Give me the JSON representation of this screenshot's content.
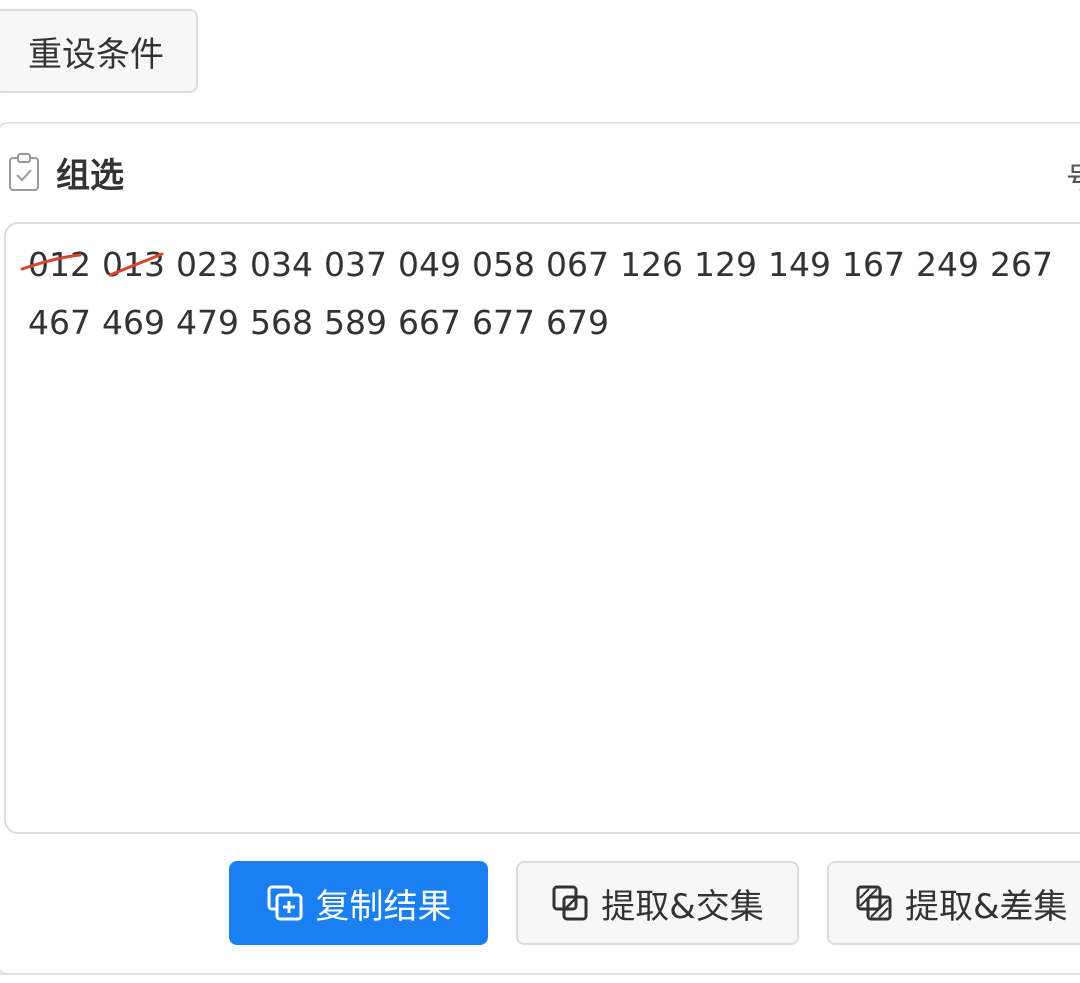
{
  "toolbar": {
    "reset_label": "重设条件"
  },
  "panel": {
    "title": "组选",
    "edge_glyph": "号",
    "icon": "clipboard-check-icon"
  },
  "result": {
    "numbers": [
      "012",
      "013",
      "023",
      "034",
      "037",
      "049",
      "058",
      "067",
      "126",
      "129",
      "149",
      "167",
      "249",
      "267",
      "467",
      "469",
      "479",
      "568",
      "589",
      "667",
      "677",
      "679"
    ],
    "struck_out": [
      "012",
      "013"
    ]
  },
  "actions": {
    "copy_label": "复制结果",
    "intersect_label": "提取&交集",
    "difference_label": "提取&差集"
  },
  "colors": {
    "primary": "#1a7ff0",
    "strike": "#d9452f",
    "text": "#333333",
    "border": "#dcdcdc"
  }
}
